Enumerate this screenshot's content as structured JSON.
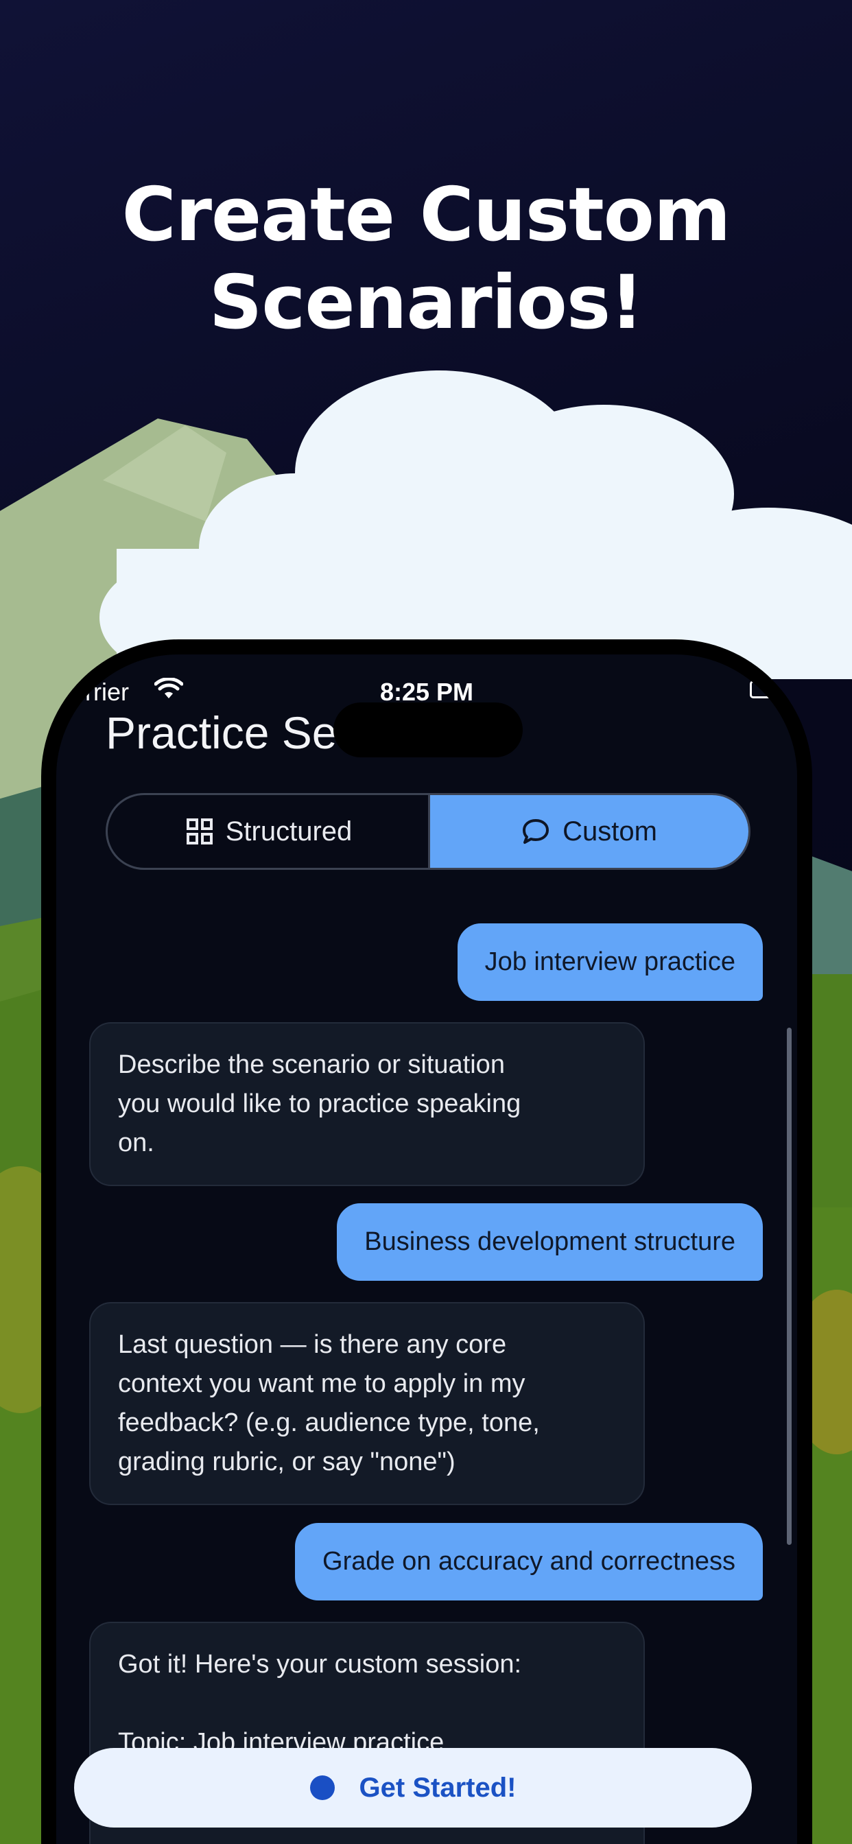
{
  "headline": {
    "line1": "Create Custom",
    "line2": "Scenarios!"
  },
  "status_bar": {
    "carrier": "rrier",
    "time": "8:25 PM"
  },
  "page": {
    "title": "Practice Se"
  },
  "mode_toggle": {
    "structured_label": "Structured",
    "custom_label": "Custom",
    "selected": "Custom"
  },
  "chat": {
    "messages": [
      {
        "role": "user",
        "text": "Job interview practice"
      },
      {
        "role": "assistant",
        "lines": [
          "Describe the scenario or situation",
          "you would like to practice speaking",
          "on."
        ]
      },
      {
        "role": "user",
        "text": "Business development structure"
      },
      {
        "role": "assistant",
        "lines": [
          "Last question — is there any core",
          "context you want me to apply in my",
          "feedback? (e.g. audience type, tone,",
          "grading rubric, or say \"none\")"
        ]
      },
      {
        "role": "user",
        "text": "Grade on accuracy and correctness"
      },
      {
        "role": "assistant",
        "lines": [
          "Got it! Here's your custom session:",
          "",
          "Topic: Job interview practice"
        ]
      }
    ]
  },
  "cta": {
    "label": "Get Started!"
  },
  "colors": {
    "accent_blue": "#62a5f8",
    "bot_bubble": "#131a27",
    "background": "#070a16",
    "cta_text": "#1b52c4"
  },
  "icons": {
    "structured": "grid-icon",
    "custom": "chat-bubble-icon",
    "wifi": "wifi-icon",
    "battery": "battery-icon"
  }
}
